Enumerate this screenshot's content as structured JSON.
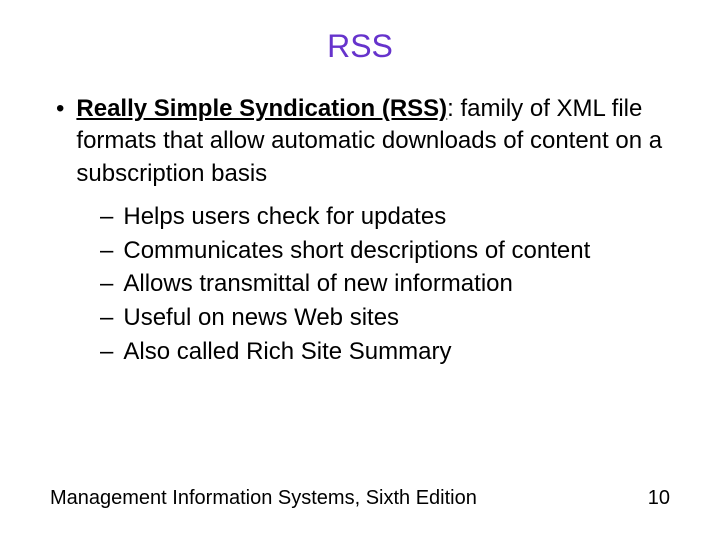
{
  "title": "RSS",
  "main": {
    "term": "Really Simple Syndication (RSS)",
    "definition": ": family of XML file formats that allow automatic downloads of content on a subscription basis"
  },
  "sub_items": [
    "Helps users check for updates",
    "Communicates short descriptions of content",
    "Allows transmittal of new information",
    "Useful on news Web sites",
    "Also called Rich Site Summary"
  ],
  "footer": {
    "left": "Management Information Systems, Sixth Edition",
    "right": "10"
  }
}
